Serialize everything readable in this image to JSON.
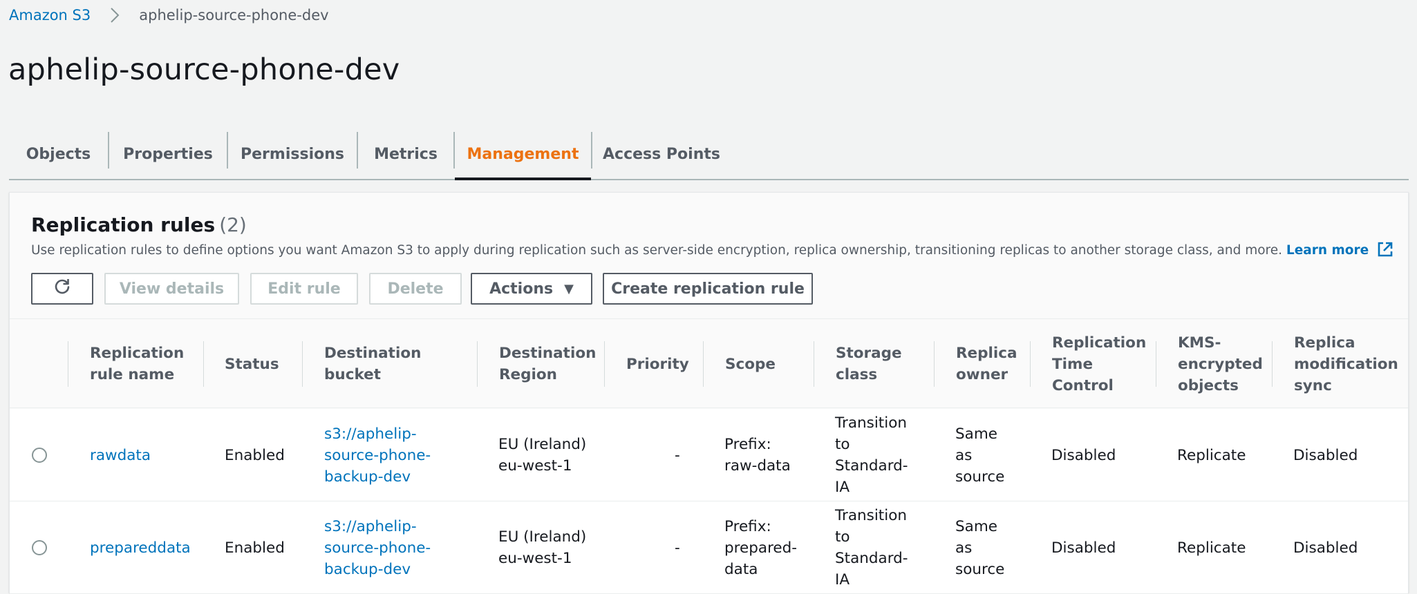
{
  "breadcrumb": {
    "root": "Amazon S3",
    "current": "aphelip-source-phone-dev"
  },
  "page_title": "aphelip-source-phone-dev",
  "tabs": [
    {
      "label": "Objects"
    },
    {
      "label": "Properties"
    },
    {
      "label": "Permissions"
    },
    {
      "label": "Metrics"
    },
    {
      "label": "Management"
    },
    {
      "label": "Access Points"
    }
  ],
  "active_tab": "Management",
  "panel": {
    "title": "Replication rules",
    "count": "(2)",
    "description": "Use replication rules to define options you want Amazon S3 to apply during replication such as server-side encryption, replica ownership, transitioning replicas to another storage class, and more.",
    "learn_more": "Learn more"
  },
  "toolbar": {
    "view_details": "View details",
    "edit_rule": "Edit rule",
    "delete": "Delete",
    "actions": "Actions",
    "actions_caret": "▼",
    "create": "Create replication rule"
  },
  "table": {
    "headers": {
      "name": [
        "Replication",
        "rule name"
      ],
      "status": [
        "Status"
      ],
      "dest_bucket": [
        "Destination",
        "bucket"
      ],
      "dest_region": [
        "Destination",
        "Region"
      ],
      "priority": [
        "Priority"
      ],
      "scope": [
        "Scope"
      ],
      "storage_class": [
        "Storage",
        "class"
      ],
      "replica_owner": [
        "Replica",
        "owner"
      ],
      "rtc": [
        "Replication",
        "Time",
        "Control"
      ],
      "kms": [
        "KMS-",
        "encrypted",
        "objects"
      ],
      "mod_sync": [
        "Replica",
        "modification",
        "sync"
      ]
    },
    "rows": [
      {
        "name": "rawdata",
        "status": "Enabled",
        "dest_bucket": [
          "s3://aphelip-",
          "source-phone-",
          "backup-dev"
        ],
        "dest_region": [
          "EU (Ireland)",
          "eu-west-1"
        ],
        "priority": "-",
        "scope": [
          "Prefix:",
          "raw-data"
        ],
        "storage_class": [
          "Transition",
          "to",
          "Standard-",
          "IA"
        ],
        "replica_owner": [
          "Same",
          "as",
          "source"
        ],
        "rtc": "Disabled",
        "kms": "Replicate",
        "mod_sync": "Disabled"
      },
      {
        "name": "prepareddata",
        "status": "Enabled",
        "dest_bucket": [
          "s3://aphelip-",
          "source-phone-",
          "backup-dev"
        ],
        "dest_region": [
          "EU (Ireland)",
          "eu-west-1"
        ],
        "priority": "-",
        "scope": [
          "Prefix:",
          "prepared-",
          "data"
        ],
        "storage_class": [
          "Transition",
          "to",
          "Standard-",
          "IA"
        ],
        "replica_owner": [
          "Same",
          "as",
          "source"
        ],
        "rtc": "Disabled",
        "kms": "Replicate",
        "mod_sync": "Disabled"
      }
    ]
  },
  "colors": {
    "link": "#0073bb",
    "active_tab": "#ec7211",
    "text": "#16191f",
    "muted": "#545b64",
    "background": "#f2f3f3"
  },
  "icons": [
    "chevron-right-icon",
    "refresh-icon",
    "external-link-icon",
    "caret-down-icon"
  ]
}
